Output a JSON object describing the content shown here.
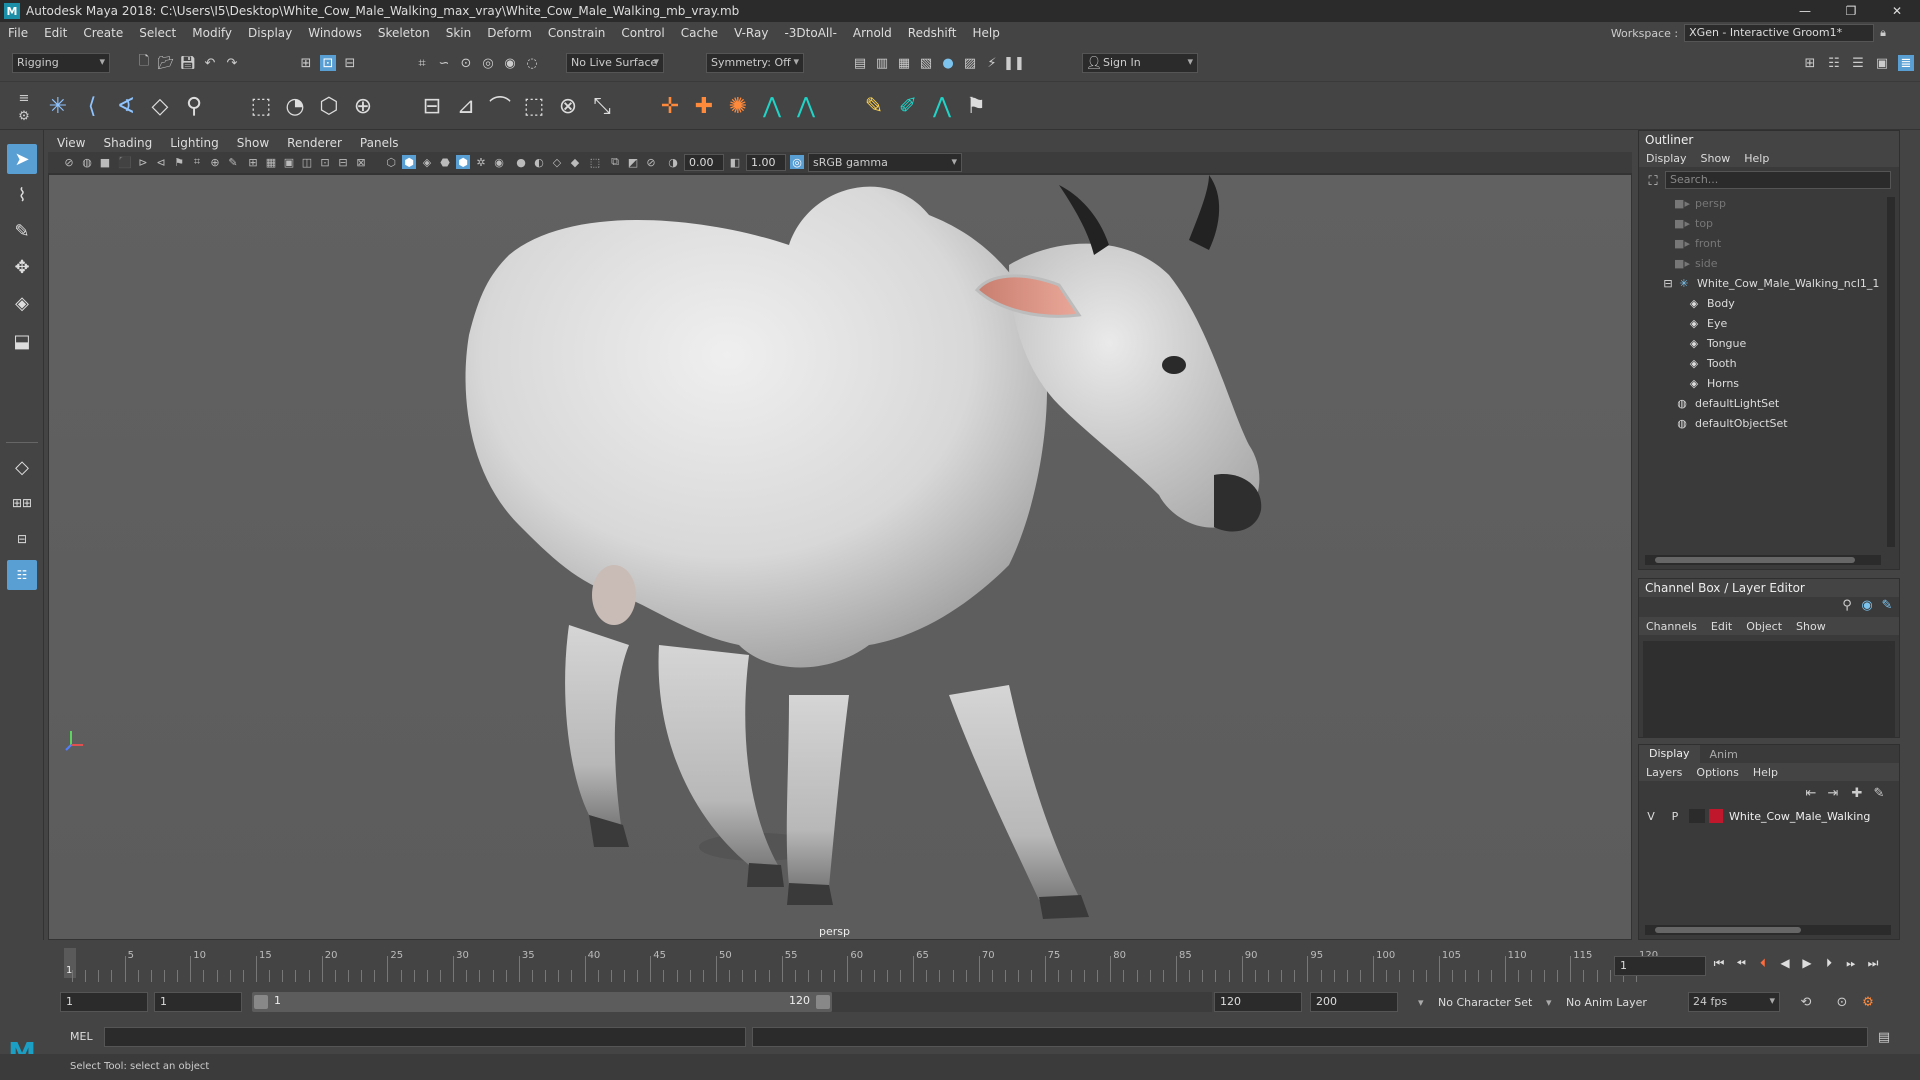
{
  "window": {
    "title": "Autodesk Maya 2018: C:\\Users\\I5\\Desktop\\White_Cow_Male_Walking_max_vray\\White_Cow_Male_Walking_mb_vray.mb",
    "logo": "M",
    "workspace_label": "Workspace :",
    "workspace_value": "XGen - Interactive Groom1*"
  },
  "menubar": [
    "File",
    "Edit",
    "Create",
    "Select",
    "Modify",
    "Display",
    "Windows",
    "Skeleton",
    "Skin",
    "Deform",
    "Constrain",
    "Control",
    "Cache",
    "V-Ray",
    "-3DtoAll-",
    "Arnold",
    "Redshift",
    "Help"
  ],
  "statusline": {
    "mode": "Rigging",
    "live_surface": "No Live Surface",
    "symmetry": "Symmetry: Off",
    "sign_in": "Sign In"
  },
  "panel": {
    "menus": [
      "View",
      "Shading",
      "Lighting",
      "Show",
      "Renderer",
      "Panels"
    ],
    "exposure": "0.00",
    "gamma": "1.00",
    "colorspace": "sRGB gamma",
    "camera_label": "persp"
  },
  "outliner": {
    "title": "Outliner",
    "menus": [
      "Display",
      "Show",
      "Help"
    ],
    "search_placeholder": "Search...",
    "items": [
      {
        "label": "persp",
        "icon": "camera-icon",
        "dim": true
      },
      {
        "label": "top",
        "icon": "camera-icon",
        "dim": true
      },
      {
        "label": "front",
        "icon": "camera-icon",
        "dim": true
      },
      {
        "label": "side",
        "icon": "camera-icon",
        "dim": true
      },
      {
        "label": "White_Cow_Male_Walking_ncl1_1",
        "icon": "joint-icon",
        "dim": false
      },
      {
        "label": "Body",
        "icon": "mesh-icon",
        "dim": false
      },
      {
        "label": "Eye",
        "icon": "mesh-icon",
        "dim": false
      },
      {
        "label": "Tongue",
        "icon": "mesh-icon",
        "dim": false
      },
      {
        "label": "Tooth",
        "icon": "mesh-icon",
        "dim": false
      },
      {
        "label": "Horns",
        "icon": "mesh-icon",
        "dim": false
      },
      {
        "label": "defaultLightSet",
        "icon": "set-icon",
        "dim": false
      },
      {
        "label": "defaultObjectSet",
        "icon": "set-icon",
        "dim": false
      }
    ]
  },
  "channelbox": {
    "title": "Channel Box / Layer Editor",
    "menus": [
      "Channels",
      "Edit",
      "Object",
      "Show"
    ]
  },
  "layereditor": {
    "tabs": [
      "Display",
      "Anim"
    ],
    "menus": [
      "Layers",
      "Options",
      "Help"
    ],
    "layer": {
      "v": "V",
      "p": "P",
      "name": "White_Cow_Male_Walking",
      "color": "#c0172c"
    }
  },
  "timeslider": {
    "ticks": [
      "5",
      "10",
      "15",
      "20",
      "25",
      "30",
      "35",
      "40",
      "45",
      "50",
      "55",
      "60",
      "65",
      "70",
      "75",
      "80",
      "85",
      "90",
      "95",
      "100",
      "105",
      "110",
      "115",
      "120"
    ],
    "current_frame_marker": "1",
    "current_frame": "1"
  },
  "range": {
    "start": "1",
    "anim_start": "1",
    "slider_start": "1",
    "slider_end": "120",
    "end": "120",
    "anim_end": "200",
    "character_set": "No Character Set",
    "anim_layer": "No Anim Layer",
    "fps": "24 fps"
  },
  "cmdline": {
    "label": "MEL"
  },
  "helpline": {
    "text": "Select Tool: select an object"
  },
  "colors": {
    "accent": "#5a9fd4",
    "layer_color": "#c0172c"
  }
}
